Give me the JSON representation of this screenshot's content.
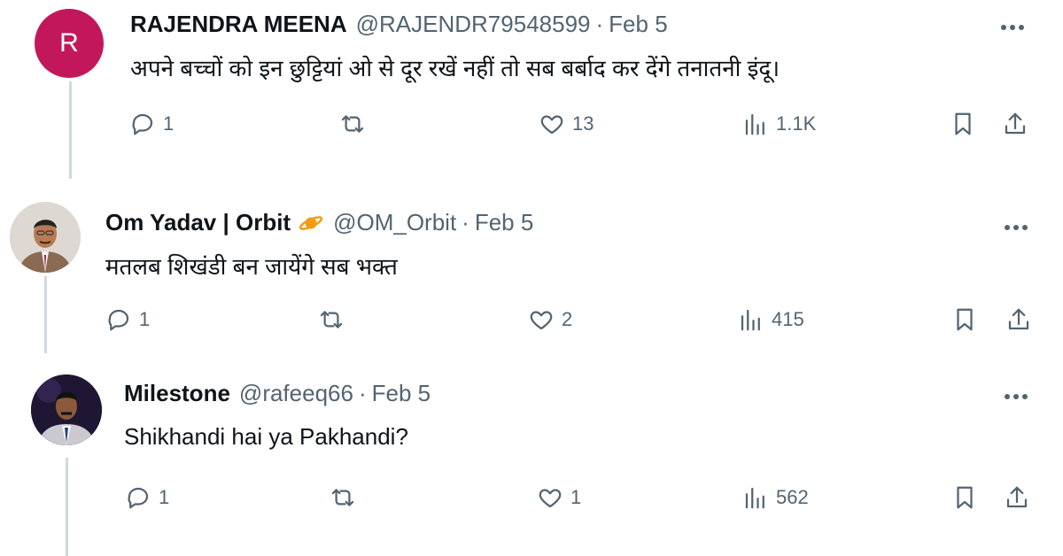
{
  "tweets": [
    {
      "avatar_letter": "R",
      "avatar_color": "#c2185b",
      "display_name": "RAJENDRA MEENA",
      "handle": "@RAJENDR79548599",
      "separator": "·",
      "date": "Feb 5",
      "text": "अपने बच्चों को इन छुट्टियां ओ से दूर रखें नहीं तो सब बर्बाद कर देंगे तनातनी इंदू।",
      "stats": {
        "replies": "1",
        "likes": "13",
        "views": "1.1K"
      }
    },
    {
      "avatar_icon": "user-photo",
      "display_name": "Om Yadav | Orbit",
      "badge_icon": "orbit-planet-icon",
      "handle": "@OM_Orbit",
      "separator": "·",
      "date": "Feb 5",
      "text": "मतलब शिखंडी बन जायेंगे सब भक्त",
      "stats": {
        "replies": "1",
        "likes": "2",
        "views": "415"
      }
    },
    {
      "avatar_icon": "user-photo",
      "display_name": "Milestone",
      "handle": "@rafeeq66",
      "separator": "·",
      "date": "Feb 5",
      "text": "Shikhandi hai ya Pakhandi?",
      "stats": {
        "replies": "1",
        "likes": "1",
        "views": "562"
      }
    }
  ],
  "icons": {
    "reply": "speech-bubble-icon",
    "retweet": "retweet-arrows-icon",
    "like": "heart-icon",
    "views": "bar-chart-icon",
    "bookmark": "bookmark-icon",
    "share": "share-upload-icon",
    "more": "three-dots-icon"
  },
  "colors": {
    "text_primary": "#0f1419",
    "text_secondary": "#536471",
    "thread_line": "#cfd9de",
    "orbit_badge": "#f39c12"
  }
}
